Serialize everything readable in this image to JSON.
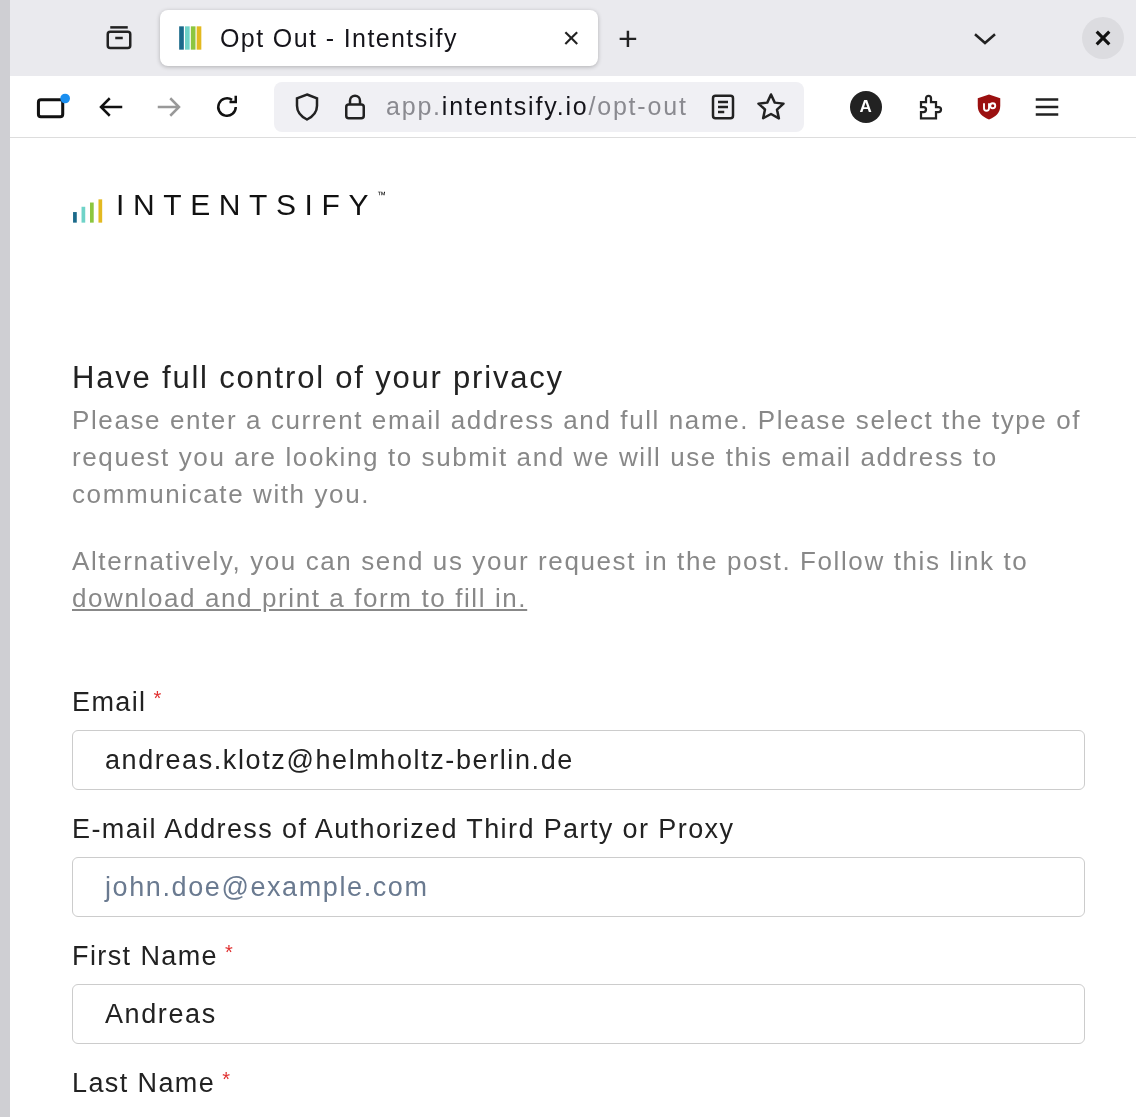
{
  "browser": {
    "tab": {
      "title": "Opt Out - Intentsify",
      "close": "×",
      "selected": true
    },
    "new_tab": "+",
    "address": {
      "prefix": "app.",
      "domain": "intentsify.io",
      "path": "/opt-out"
    },
    "profile_letter": "A"
  },
  "logo": {
    "text": "INTENTSIFY",
    "mark": "™"
  },
  "heading": "Have full control of your privacy",
  "intro": "Please enter a current email address and full name. Please select the type of request you are looking to submit and we will use this email address to communicate with you.",
  "alternative": {
    "text": "Alternatively, you can send us your request in the post. Follow this link to ",
    "link": "download and print a form to fill in."
  },
  "fields": [
    {
      "label": "Email",
      "required": true,
      "value": "andreas.klotz@helmholtz-berlin.de"
    },
    {
      "label": "E-mail Address of Authorized Third Party or Proxy",
      "required": false,
      "placeholder": "john.doe@example.com"
    },
    {
      "label": "First Name",
      "required": true,
      "value": "Andreas"
    },
    {
      "label": "Last Name",
      "required": true
    }
  ],
  "required_mark": "*"
}
